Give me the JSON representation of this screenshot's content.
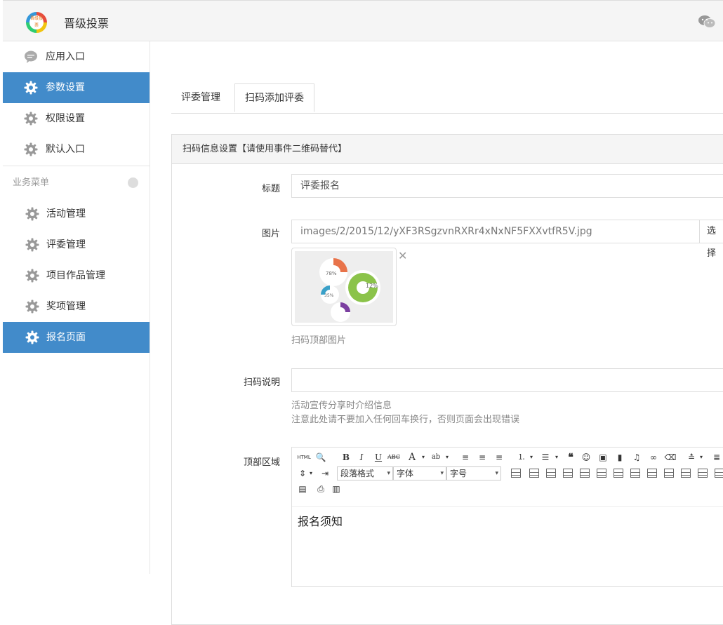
{
  "app": {
    "title": "晋级投票",
    "logo_text": "晋级投票"
  },
  "sidebar": {
    "top_items": [
      {
        "label": "应用入口",
        "icon": "comment-icon",
        "active": false
      },
      {
        "label": "参数设置",
        "icon": "gear-icon",
        "active": true
      },
      {
        "label": "权限设置",
        "icon": "gear-icon",
        "active": false
      },
      {
        "label": "默认入口",
        "icon": "gear-icon",
        "active": false
      }
    ],
    "section_title": "业务菜单",
    "sub_items": [
      {
        "label": "活动管理",
        "icon": "gear-icon",
        "active": false
      },
      {
        "label": "评委管理",
        "icon": "gear-icon",
        "active": false
      },
      {
        "label": "项目作品管理",
        "icon": "gear-icon",
        "active": false
      },
      {
        "label": "奖项管理",
        "icon": "gear-icon",
        "active": false
      },
      {
        "label": "报名页面",
        "icon": "gear-icon",
        "active": true
      }
    ]
  },
  "tabs": [
    {
      "label": "评委管理",
      "active": false
    },
    {
      "label": "扫码添加评委",
      "active": true
    }
  ],
  "panel": {
    "heading": "扫码信息设置【请使用事件二维码替代】",
    "title_label": "标题",
    "title_value": "评委报名",
    "image_label": "图片",
    "image_value": "images/2/2015/12/yXF3RSgzvnRXRr4xNxNF5FXXvtfR5V.jpg",
    "image_pick_button": "选择",
    "image_help": "扫码顶部图片",
    "desc_label": "扫码说明",
    "desc_value": "",
    "desc_help_1": "活动宣传分享时介绍信息",
    "desc_help_2": "注意此处请不要加入任何回车换行，否则页面会出现错误",
    "top_area_label": "顶部区域",
    "editor": {
      "paragraph_select": "段落格式",
      "font_select": "字体",
      "size_select": "字号",
      "html_button": "HTML",
      "content": "报名须知"
    }
  },
  "thumb_labels": [
    "78%",
    "35%",
    "12%"
  ],
  "colors": {
    "accent": "#428bca",
    "topbar": "#f5f5f5"
  }
}
